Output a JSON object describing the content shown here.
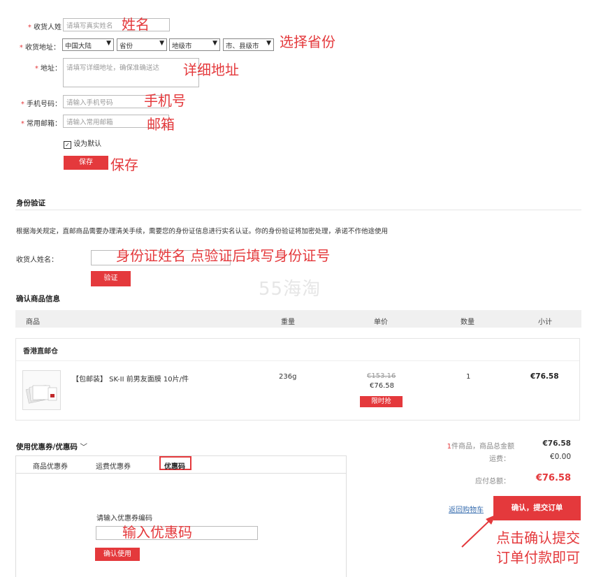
{
  "address_form": {
    "name_label": "收货人姓",
    "name_placeholder": "请填写真实姓名",
    "region_label": "收货地址",
    "region_selects": [
      "中国大陆",
      "省份",
      "地级市",
      "市、县级市"
    ],
    "address_label": "地址",
    "address_placeholder": "请填写详细地址，确保准确送达",
    "phone_label": "手机号码",
    "phone_placeholder": "请输入手机号码",
    "email_label": "常用邮箱",
    "email_placeholder": "请输入常用邮箱",
    "default_checkbox_label": "设为默认",
    "save_button": "保存"
  },
  "annotations": {
    "name": "姓名",
    "province": "选择省份",
    "address": "详细地址",
    "phone": "手机号",
    "email": "邮箱",
    "save": "保存",
    "id_hint": "身份证姓名 点验证后填写身份证号",
    "coupon_hint": "输入优惠码",
    "submit_hint_line1": "点击确认提交",
    "submit_hint_line2": "订单付款即可"
  },
  "identity": {
    "title": "身份验证",
    "notice": "根据海关规定，直邮商品需要办理清关手续，需要您的身份证信息进行实名认证。你的身份验证将加密处理，承诺不作他途使用",
    "name_label": "收货人姓名：",
    "verify_button": "验证"
  },
  "watermark": "55海淘",
  "order": {
    "title": "确认商品信息",
    "columns": [
      "商品",
      "重量",
      "单价",
      "数量",
      "小计"
    ],
    "warehouse": "香港直邮仓",
    "item": {
      "name": "【包邮装】 SK-II 前男友面膜 10片/件",
      "weight": "236g",
      "original_price": "€153.16",
      "price": "€76.58",
      "badge": "限时抢",
      "quantity": "1",
      "subtotal": "€76.58"
    }
  },
  "coupon": {
    "title": "使用优惠券/优惠码",
    "tabs": [
      "商品优惠券",
      "运费优惠券",
      "优惠码"
    ],
    "prompt": "请输入优惠券编码",
    "confirm_button": "确认使用"
  },
  "summary": {
    "count_text_prefix": "1",
    "count_text_suffix": "件商品，商品总金额",
    "goods_total": "€76.58",
    "shipping_label": "运费：",
    "shipping": "€0.00",
    "payable_label": "应付总额：",
    "payable": "€76.58",
    "back_link": "返回购物车",
    "submit_button": "确认，提交订单"
  },
  "colors": {
    "accent": "#e4393c"
  }
}
